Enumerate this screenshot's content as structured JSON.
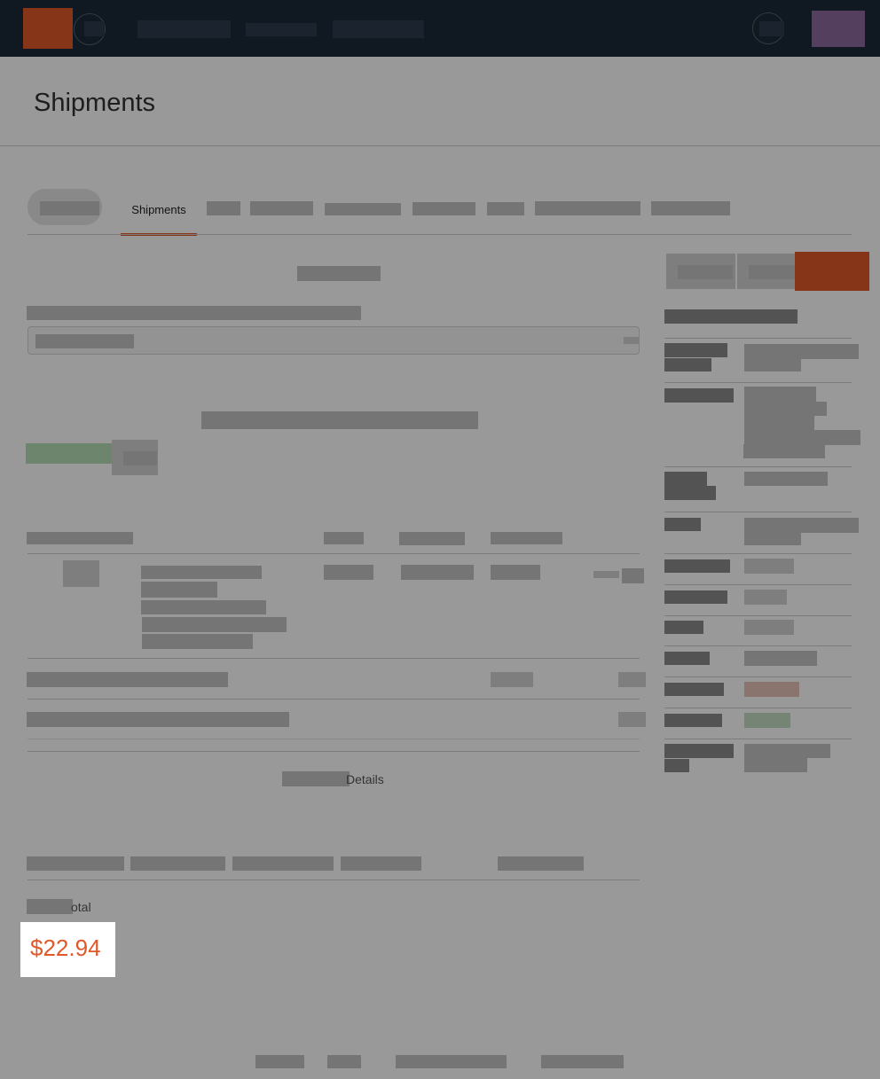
{
  "page": {
    "title": "Shipments"
  },
  "tabs": {
    "active_label": "Shipments"
  },
  "details": {
    "label_fragment": "Details"
  },
  "summary": {
    "total_label_fragment": "otal",
    "total_value": "$22.94"
  },
  "colors": {
    "accent": "#e0592a",
    "topbar": "#1b2a3a",
    "avatar": "#8e6a9f"
  },
  "icons": {
    "logo": "brand-logo",
    "nav_toggle": "menu-circle-icon",
    "help": "help-circle-icon"
  }
}
